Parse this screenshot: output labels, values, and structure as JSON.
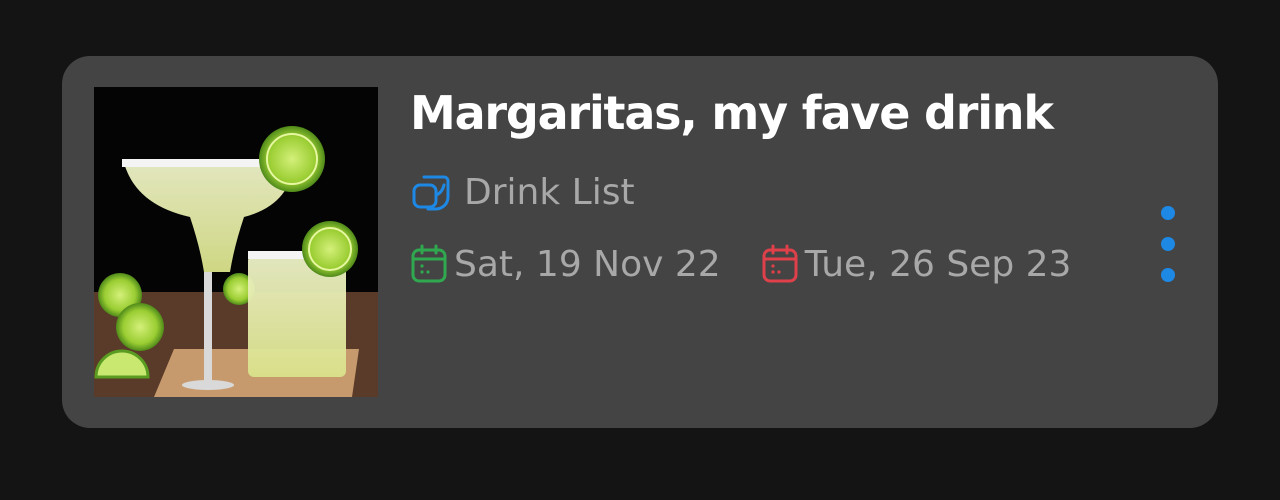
{
  "card": {
    "title": "Margaritas, my fave drink",
    "list_name": "Drink List",
    "list_icon": "list-copy-icon",
    "start_date": "Sat, 19 Nov 22",
    "end_date": "Tue, 26 Sep 23",
    "start_icon": "calendar-icon",
    "end_icon": "calendar-icon",
    "more_icon": "more-vertical-icon"
  },
  "colors": {
    "background": "#141414",
    "card": "#444444",
    "title": "#ffffff",
    "secondary_text": "#a8a8a8",
    "accent_blue": "#1e88e5",
    "start_green": "#2fa84f",
    "end_red": "#e0404a"
  }
}
